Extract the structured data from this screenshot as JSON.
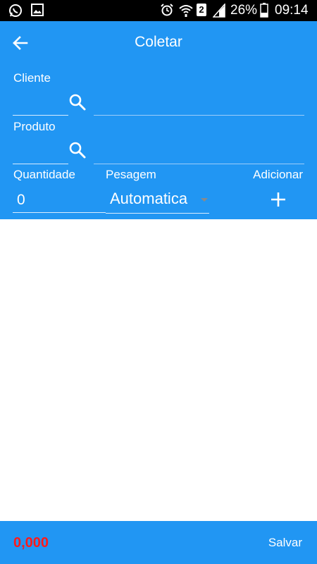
{
  "status_bar": {
    "battery_percent": "26%",
    "time": "09:14",
    "sim_slot": "2",
    "icons": [
      "whatsapp-icon",
      "gallery-icon",
      "alarm-icon",
      "wifi-icon",
      "signal-icon",
      "battery-icon"
    ]
  },
  "app_bar": {
    "title": "Coletar",
    "back_icon": "arrow-back-icon"
  },
  "form": {
    "cliente": {
      "label": "Cliente",
      "code_value": "",
      "description_value": ""
    },
    "produto": {
      "label": "Produto",
      "code_value": "",
      "description_value": ""
    },
    "quantidade": {
      "label": "Quantidade",
      "value": "0"
    },
    "pesagem": {
      "label": "Pesagem",
      "selected": "Automatica"
    },
    "adicionar": {
      "label": "Adicionar",
      "icon": "plus-icon"
    }
  },
  "footer": {
    "total": "0,000",
    "save_label": "Salvar"
  },
  "colors": {
    "primary": "#2196f3",
    "total_text": "#ff1a1a",
    "status_bar": "#000000",
    "content_bg": "#ffffff"
  }
}
